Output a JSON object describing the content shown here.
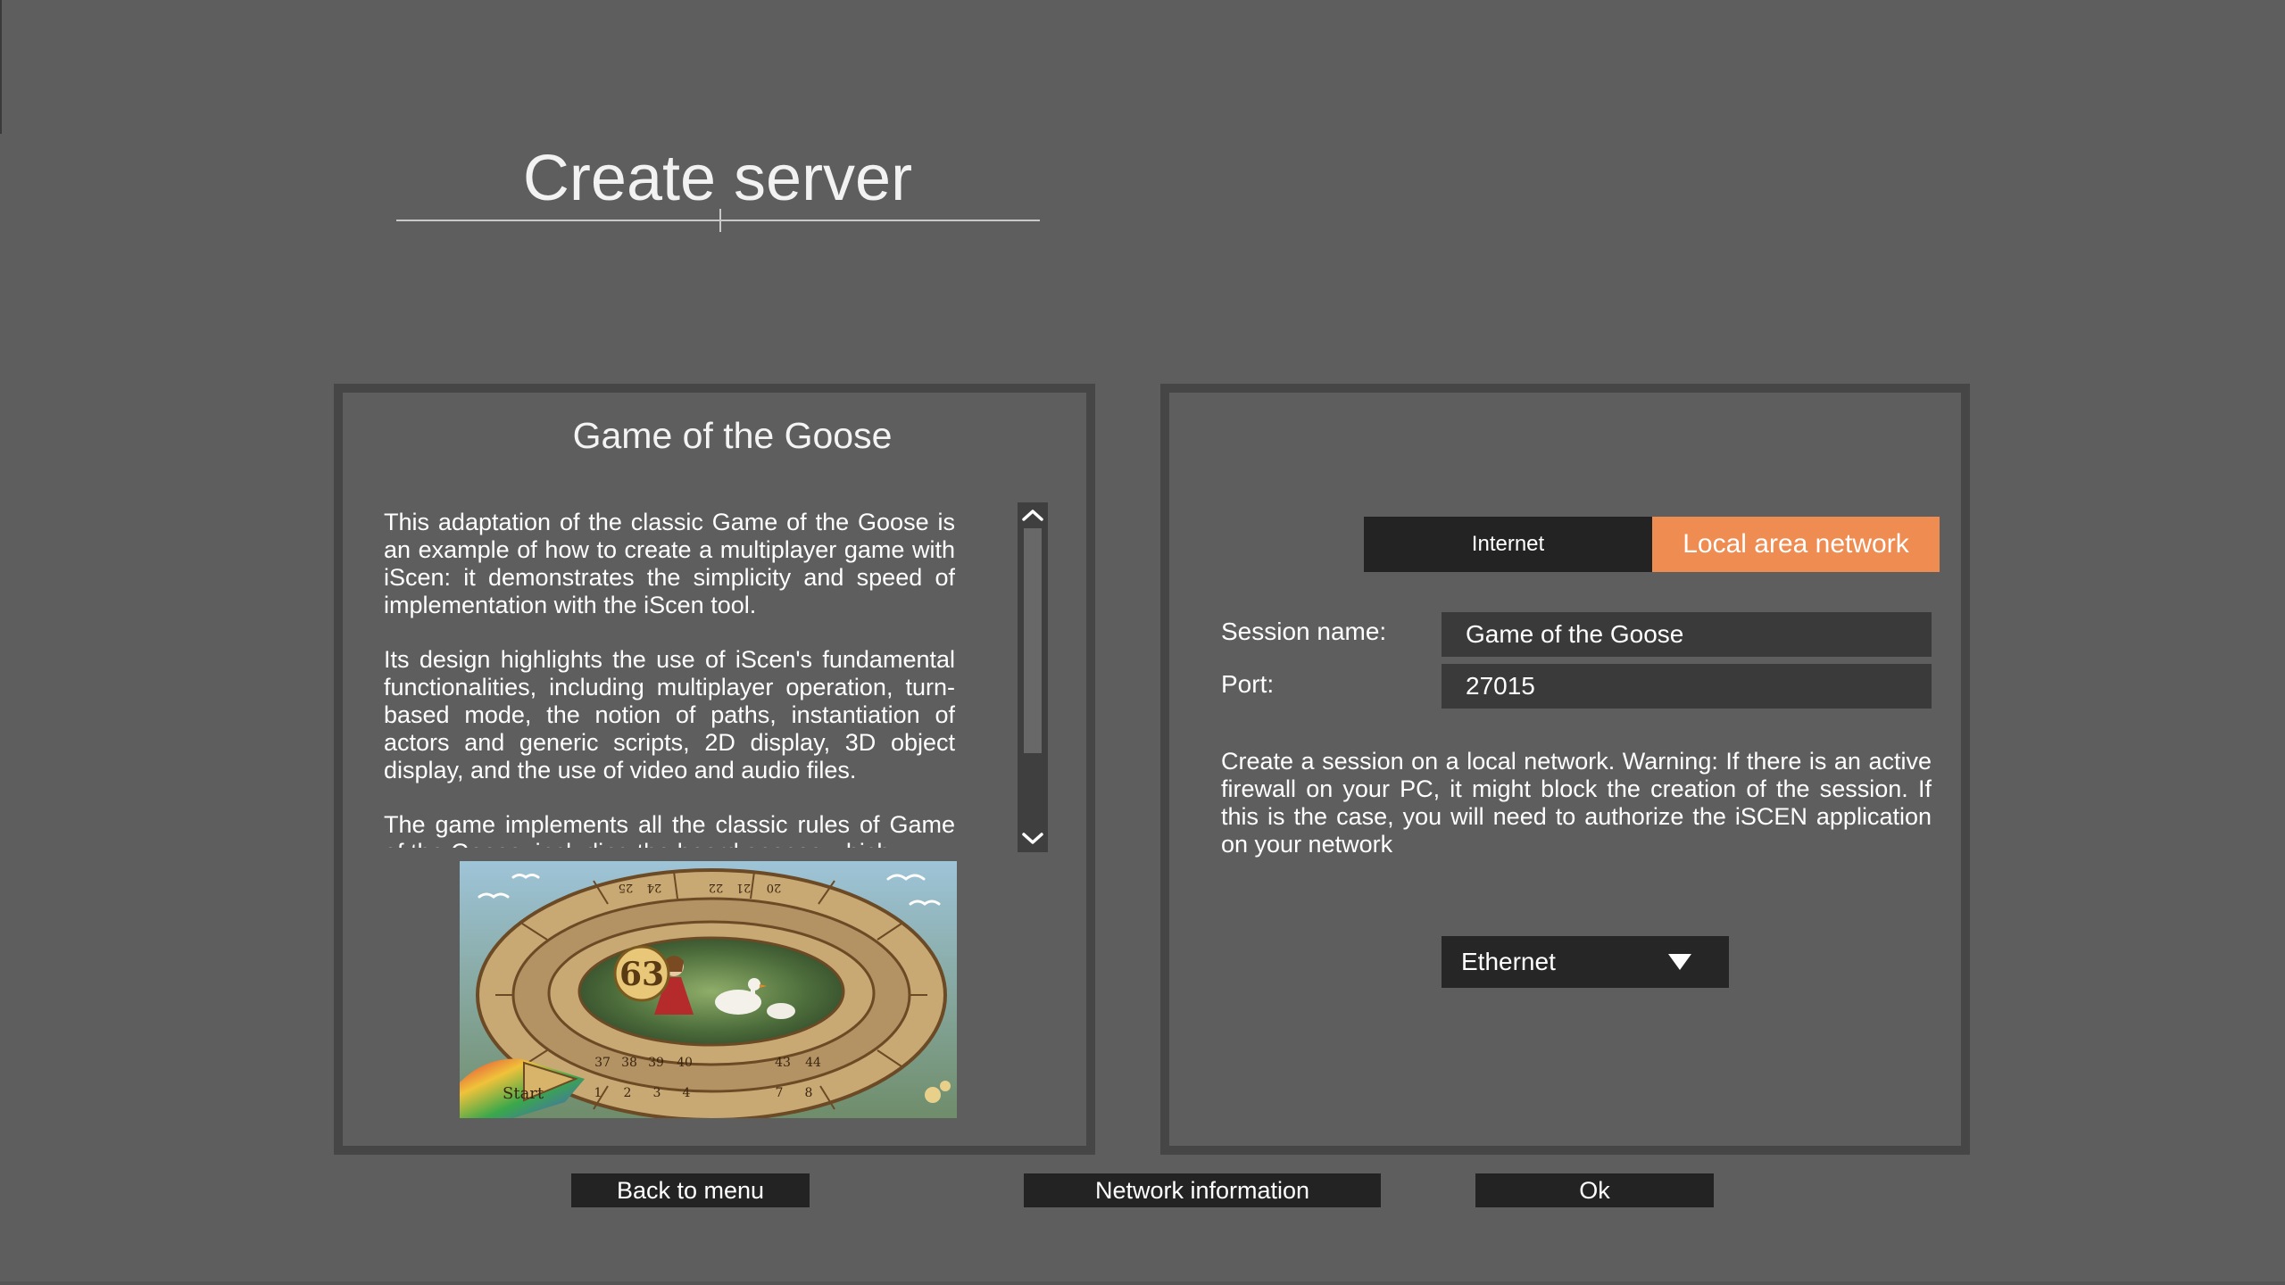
{
  "page": {
    "title": "Create server"
  },
  "game": {
    "name": "Game of the Goose",
    "description": [
      "This adaptation of the classic Game of the Goose is an example of how to create a multiplayer game with iScen: it demonstrates the simplicity and speed of implementation with the iScen tool.",
      "Its design highlights the use of iScen's fundamental functionalities, including multiplayer operation, turn-based mode, the notion of paths, instantiation of actors and generic scripts, 2D display, 3D object display, and the use of video and audio files.",
      "The game implements all the classic rules of Game of the Goose, including the board spaces which..."
    ],
    "board_image": {
      "center_number": "63",
      "start_label": "Start",
      "bottom_numbers": [
        "1",
        "2",
        "3",
        "4",
        "7",
        "8"
      ],
      "lower_numbers": [
        "37",
        "38",
        "39",
        "40",
        "43",
        "44"
      ],
      "top_numbers": [
        "20",
        "21",
        "22",
        "24",
        "25"
      ]
    }
  },
  "network": {
    "tabs": [
      {
        "label": "Internet",
        "active": false
      },
      {
        "label": "Local area network",
        "active": true
      }
    ],
    "session_name_label": "Session name:",
    "session_name_value": "Game of the Goose",
    "port_label": "Port:",
    "port_value": "27015",
    "warning": "Create a session on a local network. Warning: If there is an active firewall on your PC, it might block the creation of the session. If this is the case, you will need to authorize the iSCEN application on your network",
    "adapter_selected": "Ethernet"
  },
  "buttons": {
    "back": "Back to menu",
    "network_info": "Network information",
    "ok": "Ok"
  },
  "colors": {
    "background": "#5e5e5e",
    "panel_border": "#464646",
    "active_tab": "#ef8c52",
    "button_bg": "#232323",
    "field_bg": "#3a3a3a"
  }
}
